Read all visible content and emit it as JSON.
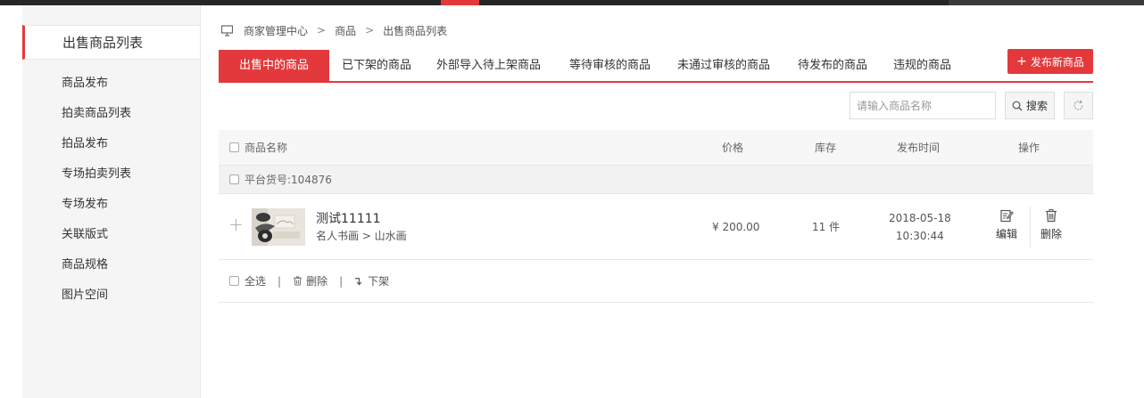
{
  "colors": {
    "accent": "#e4393c",
    "topbar": "#262626"
  },
  "sidebar": {
    "title": "出售商品列表",
    "items": [
      {
        "label": "商品发布"
      },
      {
        "label": "拍卖商品列表"
      },
      {
        "label": "拍品发布"
      },
      {
        "label": "专场拍卖列表"
      },
      {
        "label": "专场发布"
      },
      {
        "label": "关联版式"
      },
      {
        "label": "商品规格"
      },
      {
        "label": "图片空间"
      }
    ]
  },
  "breadcrumb": {
    "icon": "monitor-icon",
    "items": [
      "商家管理中心",
      "商品",
      "出售商品列表"
    ],
    "separator": ">"
  },
  "tabs": [
    {
      "label": "出售中的商品",
      "active": true
    },
    {
      "label": "已下架的商品"
    },
    {
      "label": "外部导入待上架商品"
    },
    {
      "label": "等待审核的商品"
    },
    {
      "label": "未通过审核的商品"
    },
    {
      "label": "待发布的商品"
    },
    {
      "label": "违规的商品"
    }
  ],
  "publish_button": {
    "label": "发布新商品"
  },
  "search": {
    "placeholder": "请输入商品名称",
    "value": "",
    "button_label": "搜索"
  },
  "table": {
    "headers": {
      "name": "商品名称",
      "price": "价格",
      "stock": "库存",
      "time": "发布时间",
      "ops": "操作"
    },
    "group": {
      "label": "平台货号:104876"
    },
    "rows": [
      {
        "name": "测试11111",
        "category": "名人书画 > 山水画",
        "price": "¥ 200.00",
        "stock": "11 件",
        "date": "2018-05-18",
        "time": "10:30:44",
        "edit_label": "编辑",
        "delete_label": "删除"
      }
    ]
  },
  "footer": {
    "select_all": "全选",
    "delete": "删除",
    "offshelf": "下架"
  }
}
